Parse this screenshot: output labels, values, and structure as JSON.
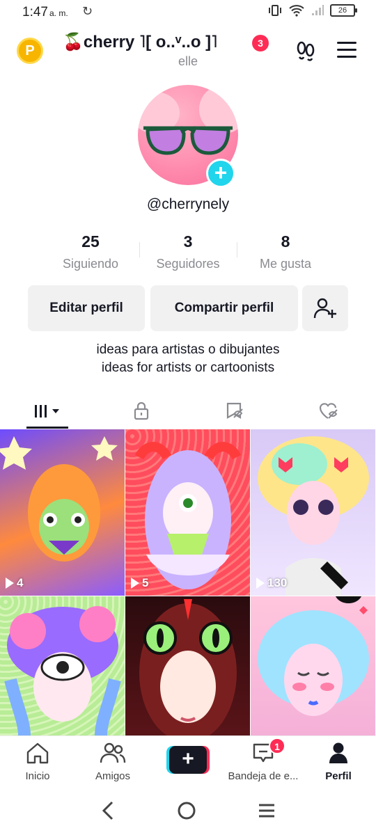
{
  "status_bar": {
    "time": "1:47",
    "ampm": "a. m.",
    "battery": "26"
  },
  "header": {
    "coin_letter": "P",
    "title": "🍒cherry ˥[ o..ᵛ..o ]˥",
    "notification_count": "3",
    "subtitle": "elle"
  },
  "profile": {
    "handle": "@cherrynely",
    "stats": [
      {
        "value": "25",
        "label": "Siguiendo"
      },
      {
        "value": "3",
        "label": "Seguidores"
      },
      {
        "value": "8",
        "label": "Me gusta"
      }
    ],
    "edit_label": "Editar perfil",
    "share_label": "Compartir perfil",
    "bio_line1": "ideas para artistas o dibujantes",
    "bio_line2": "ideas for artists or cartoonists"
  },
  "tabs": [
    {
      "icon": "grid-icon",
      "active": true
    },
    {
      "icon": "lock-icon"
    },
    {
      "icon": "repost-hidden-icon"
    },
    {
      "icon": "liked-hidden-icon"
    }
  ],
  "videos": [
    {
      "views": "4",
      "colors": [
        "#7b5cff",
        "#ff8a3d"
      ]
    },
    {
      "views": "5",
      "colors": [
        "#ff5a5a",
        "#c9a7ff"
      ]
    },
    {
      "views": "130",
      "colors": [
        "#d7c8f5",
        "#ffe6f0"
      ]
    },
    {
      "views": "",
      "colors": [
        "#b8f0a0",
        "#7fb0ff"
      ]
    },
    {
      "views": "",
      "colors": [
        "#3a0d10",
        "#7a1f1f"
      ]
    },
    {
      "views": "",
      "colors": [
        "#ffb6d9",
        "#8fd8ff"
      ]
    }
  ],
  "bottom_nav": {
    "home": "Inicio",
    "friends": "Amigos",
    "inbox": "Bandeja de e...",
    "inbox_badge": "1",
    "profile": "Perfil"
  },
  "colors": {
    "accent_red": "#fe2c55",
    "accent_cyan": "#20d5ec",
    "text": "#161823",
    "muted": "#8a8b91"
  }
}
